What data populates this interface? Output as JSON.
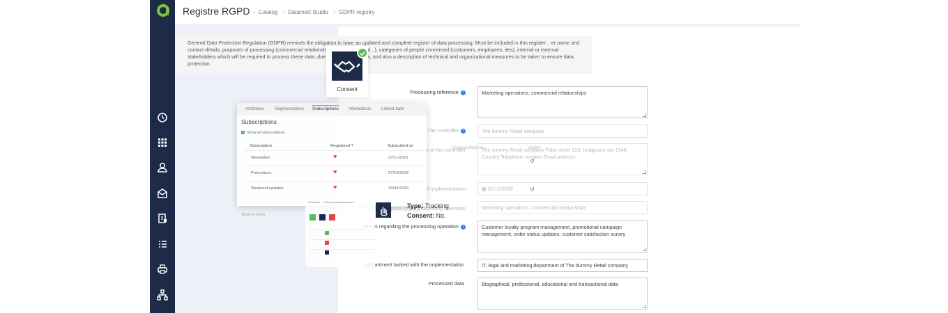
{
  "app": {
    "title": "Registre RGPD",
    "breadcrumb": [
      "Catalog",
      "Datamart Studio",
      "GDPR registry"
    ],
    "sidebar_icons": [
      "clock-icon",
      "grid-icon",
      "user-icon",
      "envelope-icon",
      "document-icon",
      "list-icon",
      "printer-icon",
      "hierarchy-icon"
    ]
  },
  "intro_text": "General Data Protection Regulation (GDPR) reminds the obligation to have an updated and complete register of data processing. Must be included in this register: , er name and contact details, purposes of processing (commercial relationship, HR management...), categories of people concerned (customers, employees, ites), internal or external stakeholders which will be required to process these data, due dates to erase data, and also a description of technical and organizational measures to be taken to ensure data protection.",
  "consent_card": {
    "label": "Consent"
  },
  "form": {
    "processing_reference": {
      "label": "Processing reference",
      "value": "Marketing operations, commercial relationships"
    },
    "controller": {
      "label": "The controller",
      "value": "The dummy Retail company"
    },
    "controller_address": {
      "label": "Name and address of the controller",
      "value": "The dummy Retail company Fake street 123, Imaginary city 1348, Country Telephone number Email address"
    },
    "implementation_date": {
      "label": "Date of implementation",
      "value": "31/12/2020"
    },
    "purpose": {
      "label": "Purpose of the processing operation",
      "value": "Marketing operations, commercial relationships"
    },
    "details": {
      "label": "Details regarding the processing operation",
      "value": "Customer loyalty program management, promotional campaign management, order status updates, customer satisfaction survey"
    },
    "department": {
      "label": "Department tasked with the implementation",
      "value": "IT, legal and marketing department of The dummy Retail company"
    },
    "processed_data": {
      "label": "Processed data",
      "value": "Biographical, professional, educational and transactional data"
    }
  },
  "overlay": {
    "tabs": [
      "Attributes",
      "Segmentations",
      "Subscriptions",
      "Interactions",
      "Linked data"
    ],
    "active_tab": "Subscriptions",
    "heading": "Subscriptions",
    "show_all": "Show all subscriptions",
    "columns": [
      "Subscription",
      "Registered ?",
      "Subscribed on",
      "Unsubscribed on",
      "History"
    ],
    "rows": [
      {
        "name": "Newsletter",
        "date": "27/11/2019"
      },
      {
        "name": "Promotions",
        "date": "27/10/2019"
      },
      {
        "name": "Weekend updates",
        "date": "15/04/2020"
      }
    ],
    "mini_tabs": [
      "Attributes",
      "Subscriptions",
      "Interactions"
    ],
    "back": "Back to menu"
  },
  "tooltip": {
    "type_label": "Type:",
    "type_value": "Tracking",
    "consent_label": "Consent:",
    "consent_value": "No."
  },
  "colors": {
    "navy": "#1e2b48",
    "green": "#5cb85c",
    "red": "#e04848",
    "blue": "#3d7fd6"
  }
}
